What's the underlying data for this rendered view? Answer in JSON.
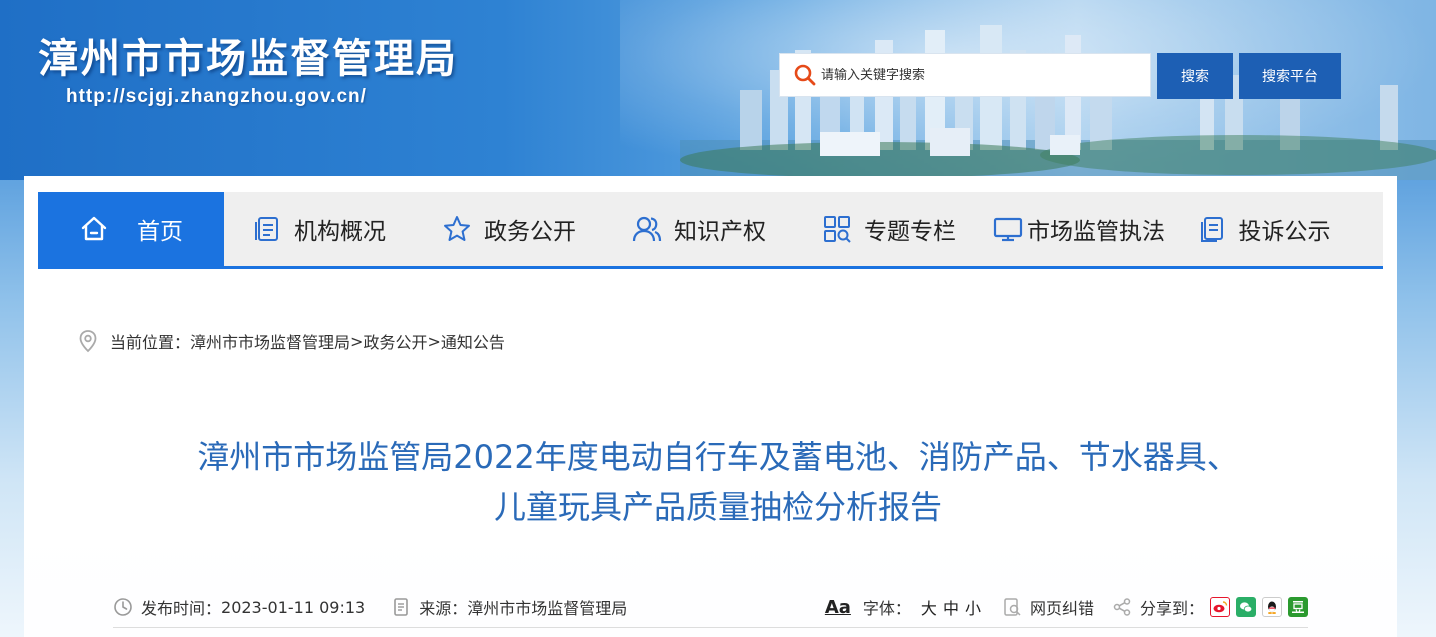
{
  "header": {
    "site_title": "漳州市市场监督管理局",
    "site_url": "http://scjgj.zhangzhou.gov.cn/",
    "search_placeholder": "请输入关键字搜索",
    "search_button": "搜索",
    "platform_button": "搜索平台"
  },
  "nav": {
    "items": [
      {
        "label": "首页",
        "icon": "home-icon"
      },
      {
        "label": "机构概况",
        "icon": "document-list-icon"
      },
      {
        "label": "政务公开",
        "icon": "star-icon"
      },
      {
        "label": "知识产权",
        "icon": "users-icon"
      },
      {
        "label": "专题专栏",
        "icon": "grid-search-icon"
      },
      {
        "label": "市场监管执法",
        "icon": "monitor-icon"
      },
      {
        "label": "投诉公示",
        "icon": "copy-doc-icon"
      }
    ],
    "active_index": 0
  },
  "breadcrumb": {
    "prefix": "当前位置：",
    "items": [
      "漳州市市场监督管理局",
      "政务公开",
      "通知公告"
    ],
    "separator": ">"
  },
  "article": {
    "title_line1": "漳州市市场监管局2022年度电动自行车及蓄电池、消防产品、节水器具、",
    "title_line2": "儿童玩具产品质量抽检分析报告"
  },
  "meta": {
    "publish_label": "发布时间：",
    "publish_time": "2023-01-11 09:13",
    "source_label": "来源：",
    "source": "漳州市市场监督管理局",
    "font_icon_text": "Aa",
    "font_label": "字体：",
    "font_sizes": [
      "大",
      "中",
      "小"
    ],
    "error_label": "网页纠错",
    "share_label": "分享到："
  },
  "colors": {
    "accent": "#1b73e0",
    "title": "#2a6ab8",
    "button": "#1d5fb4",
    "weibo": "#e6162d",
    "wechat": "#2aae67",
    "qq": "#1a1a1a",
    "douban": "#2b9a2f"
  }
}
